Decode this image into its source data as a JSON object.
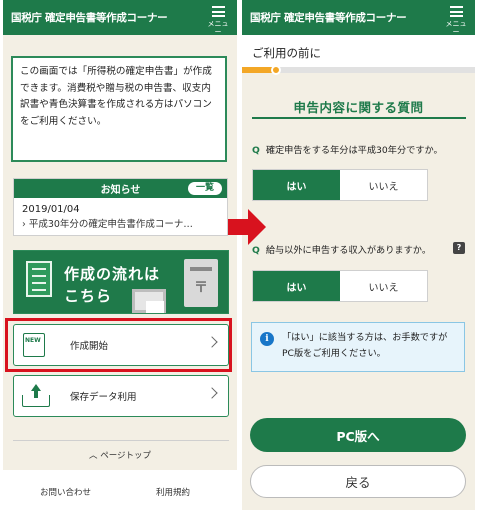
{
  "left": {
    "header": {
      "title": "国税庁 確定申告書等作成コーナー",
      "menu_label": "メニュー"
    },
    "intro_text": "この画面では「所得税の確定申告書」が作成できます。消費税や贈与税の申告書、収支内訳書や青色決算書を作成される方はパソコンをご利用ください。",
    "news": {
      "title": "お知らせ",
      "more_label": "一覧",
      "date": "2019/01/04",
      "link": "平成30年分の確定申告書作成コーナ…"
    },
    "banner": {
      "line1": "作成の流れは",
      "line2": "こちら",
      "post_symbol": "〒"
    },
    "start_button": {
      "label": "作成開始",
      "icon_tag": "NEW"
    },
    "saved_data_button": {
      "label": "保存データ利用"
    },
    "page_top": "ページトップ",
    "footer": {
      "contact": "お問い合わせ",
      "terms": "利用規約"
    }
  },
  "right": {
    "header": {
      "title": "国税庁 確定申告書等作成コーナー",
      "menu_label": "メニュー"
    },
    "subheader": "ご利用の前に",
    "progress": 0.15,
    "section_title": "申告内容に関する質問",
    "question_mark": "Q",
    "q1": {
      "text": "確定申告をする年分は平成30年分ですか。",
      "yes": "はい",
      "no": "いいえ",
      "selected": "yes"
    },
    "q2": {
      "text": "給与以外に申告する収入がありますか。",
      "yes": "はい",
      "no": "いいえ",
      "selected": "yes",
      "help": "?"
    },
    "info": {
      "icon": "i",
      "text": "「はい」に該当する方は、お手数ですがPC版をご利用ください。"
    },
    "pc_button": "PC版へ",
    "back_button": "戻る"
  },
  "colors": {
    "brand_green": "#1e7a4a",
    "highlight_red": "#d8121e",
    "progress_orange": "#f3a726",
    "info_blue": "#1876c8"
  }
}
